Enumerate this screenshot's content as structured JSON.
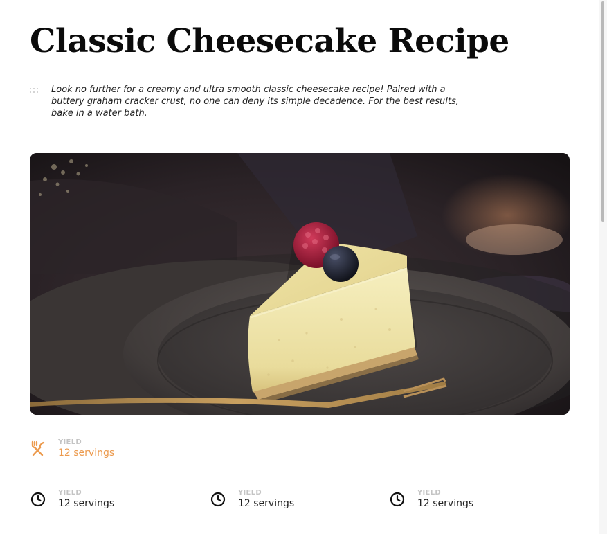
{
  "recipe": {
    "title": "Classic Cheesecake Recipe",
    "intro": "Look no further for a creamy and ultra smooth classic cheesecake recipe! Paired with a buttery graham cracker crust, no one can deny its simple decadence. For the best results, bake in a water bath."
  },
  "featured_meta": {
    "icon": "utensils-icon",
    "label": "YIELD",
    "value": "12 servings",
    "color": "#ec9a4d"
  },
  "meta_row": [
    {
      "icon": "clock-icon",
      "label": "YIELD",
      "value": "12 servings"
    },
    {
      "icon": "clock-icon",
      "label": "YIELD",
      "value": "12 servings"
    },
    {
      "icon": "clock-icon",
      "label": "YIELD",
      "value": "12 servings"
    }
  ],
  "colors": {
    "accent": "#ec9a4d",
    "label": "#c4c4c4",
    "text": "#222222"
  }
}
